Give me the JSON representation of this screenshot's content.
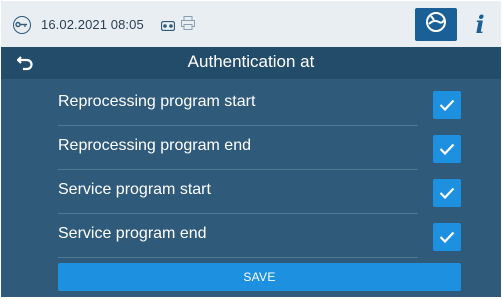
{
  "statusbar": {
    "datetime": "16.02.2021 08:05",
    "icons": [
      "key-icon",
      "tape-icon",
      "printer-icon"
    ],
    "buttons": [
      "sterilizer-icon",
      "info-icon"
    ]
  },
  "title": "Authentication at",
  "info_glyph": "i",
  "options": [
    {
      "label": "Reprocessing program start",
      "checked": true
    },
    {
      "label": "Reprocessing program end",
      "checked": true
    },
    {
      "label": "Service program start",
      "checked": true
    },
    {
      "label": "Service program end",
      "checked": true
    }
  ],
  "save_label": "SAVE",
  "colors": {
    "background": "#2f5a7a",
    "titlebar": "#234c6a",
    "accent": "#1e90e0",
    "statusbar": "#e9eef2"
  }
}
